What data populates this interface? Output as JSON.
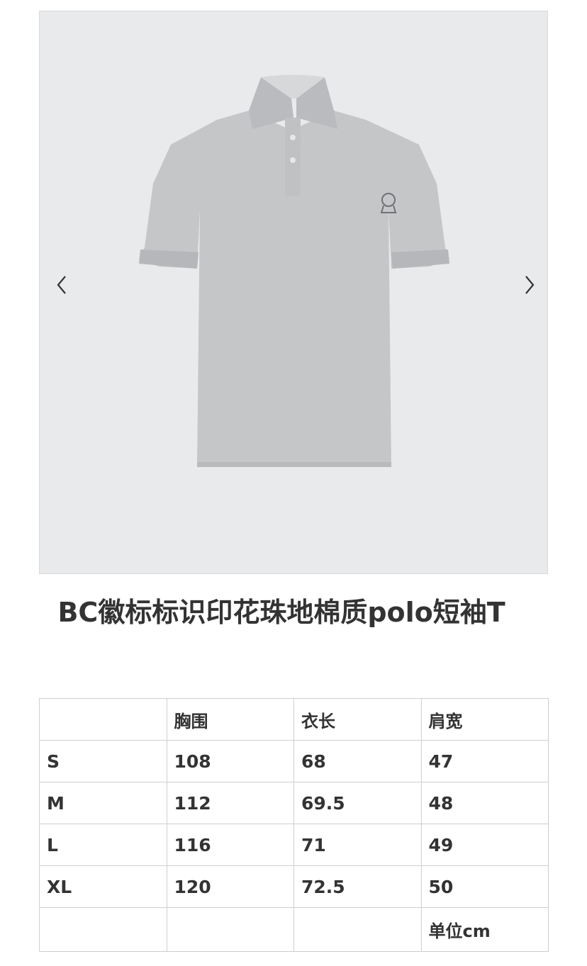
{
  "gallery": {
    "image_subject": "grey-polo-shirt",
    "prev_icon": "chevron-left-icon",
    "next_icon": "chevron-right-icon"
  },
  "product": {
    "title": "  BC徽标标识印花珠地棉质polo短袖T"
  },
  "size_table": {
    "headers": [
      "",
      "胸围",
      "衣长",
      "肩宽"
    ],
    "rows": [
      [
        "S",
        "108",
        "68",
        "47"
      ],
      [
        "M",
        "112",
        "69.5",
        "48"
      ],
      [
        "L",
        "116",
        "71",
        "49"
      ],
      [
        "XL",
        "120",
        "72.5",
        "50"
      ]
    ],
    "unit_note": "单位cm"
  },
  "colors": {
    "gallery_bg": "#e9eaec",
    "shirt": "#c4c6c8",
    "text": "#333333",
    "table_border": "#cfcfcf"
  }
}
